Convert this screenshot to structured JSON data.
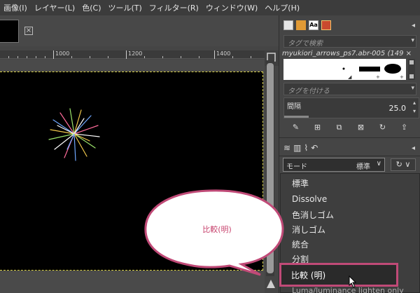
{
  "menubar": {
    "items": [
      "画像(I)",
      "レイヤー(L)",
      "色(C)",
      "ツール(T)",
      "フィルター(R)",
      "ウィンドウ(W)",
      "ヘルプ(H)"
    ]
  },
  "ruler": {
    "labels": [
      "1000",
      "1200",
      "1400"
    ]
  },
  "brushes_panel": {
    "tag_search_placeholder": "タグで検索",
    "brush_name": "myukiori_arrows_ps7.abr-005 (149 ×",
    "tag_assign_placeholder": "タグを付ける",
    "spacing_label": "間隔",
    "spacing_value": "25.0"
  },
  "layers_panel": {
    "mode_label": "モード",
    "mode_value": "標準"
  },
  "mode_dropdown": {
    "options": [
      "標準",
      "Dissolve",
      "色消しゴム",
      "消しゴム",
      "統合",
      "分割",
      "比較 (明)",
      "Luma/luminance lighten only"
    ],
    "selected": "比較 (明)"
  },
  "callout": {
    "text": "比較(明)"
  },
  "colors": {
    "highlight_border": "#c04a77",
    "selection_marquee": "#d9d24a"
  }
}
